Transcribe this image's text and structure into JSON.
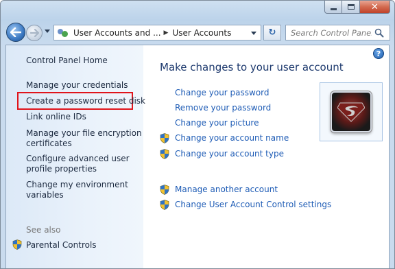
{
  "window": {
    "caption_buttons": {
      "minimize_icon": "minimize-icon",
      "maximize_icon": "maximize-icon",
      "close_glyph": "✕"
    }
  },
  "navbar": {
    "breadcrumb": [
      "User Accounts and ...",
      "User Accounts"
    ],
    "search_placeholder": "Search Control Panel"
  },
  "sidebar": {
    "home": "Control Panel Home",
    "items": [
      "Manage your credentials",
      "Create a password reset disk",
      "Link online IDs",
      "Manage your file encryption certificates",
      "Configure advanced user profile properties",
      "Change my environment variables"
    ],
    "items_wrapped": {
      "l4_line1": "Manage your file encryption",
      "l4_line2": "certificates",
      "l5_line1": "Configure advanced user",
      "l5_line2": "profile properties",
      "l6_line1": "Change my environment",
      "l6_line2": "variables"
    },
    "highlighted_item_index": 1,
    "see_also_label": "See also",
    "see_also_items": [
      "Parental Controls"
    ]
  },
  "main": {
    "title": "Make changes to your user account",
    "links": [
      {
        "label": "Change your password",
        "shield": false
      },
      {
        "label": "Remove your password",
        "shield": false
      },
      {
        "label": "Change your picture",
        "shield": false
      },
      {
        "label": "Change your account name",
        "shield": true
      },
      {
        "label": "Change your account type",
        "shield": true
      },
      {
        "label": "Manage another account",
        "shield": true
      },
      {
        "label": "Change User Account Control settings",
        "shield": true
      }
    ],
    "help_glyph": "?"
  },
  "colors": {
    "link": "#1d5bb5",
    "title": "#1e3a6e",
    "highlight_border": "#e0141b"
  }
}
